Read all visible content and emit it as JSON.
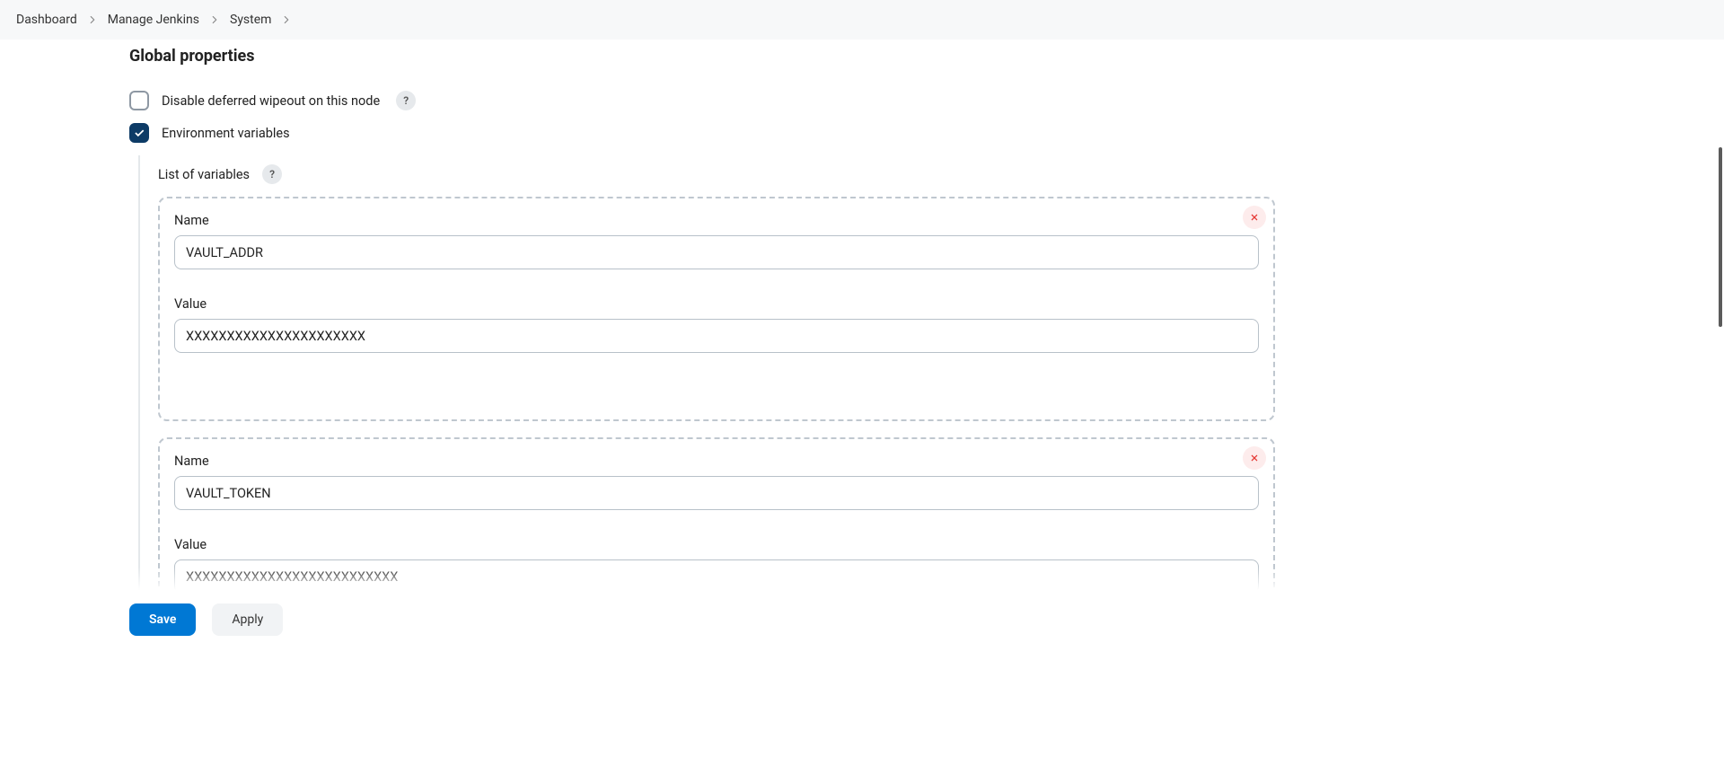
{
  "breadcrumbs": {
    "items": [
      "Dashboard",
      "Manage Jenkins",
      "System"
    ]
  },
  "section": {
    "title": "Global properties"
  },
  "properties": {
    "disable_deferred_wipeout": {
      "label": "Disable deferred wipeout on this node",
      "checked": false
    },
    "environment_variables": {
      "label": "Environment variables",
      "checked": true,
      "list_label": "List of variables",
      "fields": {
        "name_label": "Name",
        "value_label": "Value"
      },
      "vars": [
        {
          "name": "VAULT_ADDR",
          "value": "XXXXXXXXXXXXXXXXXXXXXX"
        },
        {
          "name": "VAULT_TOKEN",
          "value": "XXXXXXXXXXXXXXXXXXXXXXXXXX"
        }
      ]
    }
  },
  "footer": {
    "save_label": "Save",
    "apply_label": "Apply"
  },
  "help_glyph": "?"
}
